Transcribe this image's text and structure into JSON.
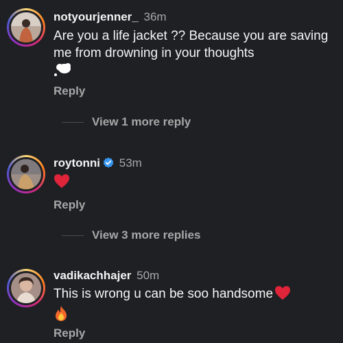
{
  "comments": [
    {
      "username": "notyourjenner_",
      "time": "36m",
      "verified": false,
      "text": "Are you a life jacket ?? Because you are saving me from drowning in your thoughts",
      "emoji_after_text": "thought-balloon",
      "reply_label": "Reply",
      "view_more_label": "View 1 more reply"
    },
    {
      "username": "roytonni",
      "time": "53m",
      "verified": true,
      "text": "",
      "emoji_after_text": "red-heart",
      "reply_label": "Reply",
      "view_more_label": "View 3 more replies"
    },
    {
      "username": "vadikachhajer",
      "time": "50m",
      "verified": false,
      "text": "This is wrong u can be soo handsome",
      "emoji_after_text": "red-heart, fire",
      "reply_label": "Reply",
      "view_more_label": ""
    }
  ],
  "colors": {
    "background": "#1f2024",
    "primary_text": "#f5f5f5",
    "secondary_text": "#a8a8a8",
    "verified_blue": "#3897f0"
  }
}
